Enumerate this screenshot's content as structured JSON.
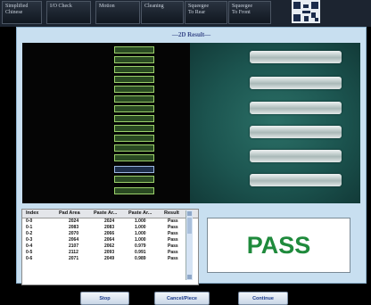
{
  "toolbar": {
    "buttons": [
      {
        "line1": "Simplified",
        "line2": "Chinese"
      },
      {
        "line1": "I/O Check",
        "line2": ""
      },
      {
        "line1": "Motion",
        "line2": ""
      },
      {
        "line1": "Cleaning",
        "line2": ""
      },
      {
        "line1": "Squeegee",
        "line2": "To Rear"
      },
      {
        "line1": "Squeegee",
        "line2": "To Front"
      }
    ]
  },
  "dialog": {
    "title": "—2D Result—",
    "table": {
      "headers": [
        "Index",
        "Pad Area",
        "Paste Ar...",
        "Paste Ar...",
        "Result"
      ],
      "rows": [
        [
          "0-0",
          "2024",
          "2024",
          "1.000",
          "Pass"
        ],
        [
          "0-1",
          "2083",
          "2083",
          "1.000",
          "Pass"
        ],
        [
          "0-2",
          "2070",
          "2066",
          "1.000",
          "Pass"
        ],
        [
          "0-3",
          "2064",
          "2064",
          "1.000",
          "Pass"
        ],
        [
          "0-4",
          "2107",
          "2062",
          "0.979",
          "Pass"
        ],
        [
          "0-5",
          "2112",
          "2093",
          "0.991",
          "Pass"
        ],
        [
          "0-6",
          "2071",
          "2049",
          "0.989",
          "Pass"
        ]
      ]
    },
    "result": "PASS",
    "result_color": "#1f8a3c",
    "buttons": {
      "stop": "Stop",
      "cancel": "Cancel/Piece",
      "continue": "Continue"
    }
  }
}
